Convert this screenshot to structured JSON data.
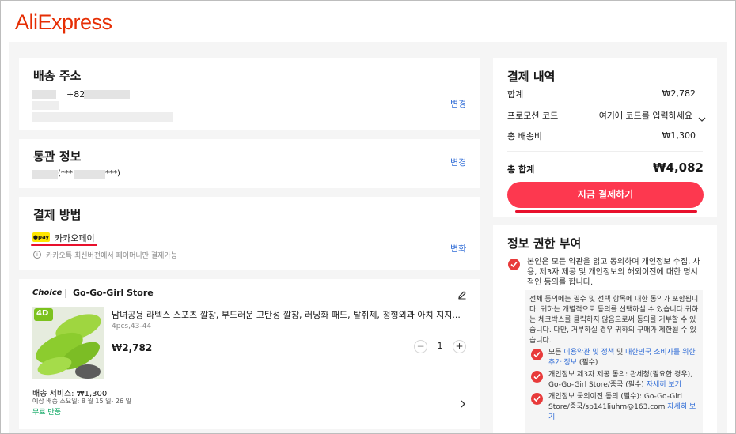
{
  "app": {
    "logo": "AliExpress",
    "brand_color": "#e62e04"
  },
  "shipping": {
    "title": "배송 주소",
    "phone_prefix": "+82",
    "change_label": "변경"
  },
  "customs": {
    "title": "통관 정보",
    "masked_id": "(***",
    "masked_tail": "***)",
    "change_label": "변경"
  },
  "payment_method": {
    "title": "결제 방법",
    "badge": "●pay",
    "method": "카카오페이",
    "notice": "카카오톡 최신버전에서 페이머니만 결제가능",
    "change_label": "변화"
  },
  "store": {
    "choice_label": "Choice",
    "name": "Go-Go-Girl Store",
    "item": {
      "title": "남녀공용 라텍스 스포츠 깔창, 부드러운 고탄성 깔창, 러닝화 패드, 탈취제, 정형외과 아치 지지...",
      "variant": "4pcs,43-44",
      "price": "₩2,782",
      "quantity": "1",
      "image_badge": "4D"
    },
    "shipping_service": "배송 서비스: ₩1,300",
    "delivery_estimate": "예상 배송 소요일: 8 월 15 일- 26 일",
    "free_return": "무료 반품"
  },
  "summary": {
    "title": "결제 내역",
    "subtotal_label": "합계",
    "subtotal_value": "₩2,782",
    "promo_label": "프로모션 코드",
    "promo_placeholder": "여기에 코드를 입력하세요",
    "shipping_label": "총 배송비",
    "shipping_value": "₩1,300",
    "total_label": "총 합계",
    "total_value": "₩4,082",
    "pay_button": "지금 결제하기"
  },
  "consent": {
    "title": "정보 권한 부여",
    "main": "본인은 모든 약관을 읽고 동의하며 개인정보 수집, 사용, 제3자 제공 및 개인정보의 해외이전에 대한 명시적인 동의를 합니다.",
    "note": "전체 동의에는 필수 및 선택 항목에 대한 동의가 포함됩니다. 귀하는 개별적으로 동의를 선택하실 수 있습니다.귀하는 체크박스를 클릭하지 않음으로써 동의를 거부할 수 있습니다. 다만, 거부하실 경우 귀하의 구매가 제한될 수 있습니다.",
    "item1_pre": "모든 ",
    "item1_link1": "이용약관 및 정책",
    "item1_mid": " 및 ",
    "item1_link2": "대한민국 소비자를 위한 추가 정보",
    "item1_post": " (필수)",
    "item2_text": "개인정보 제3자 제공 동의: 관세청(필요한 경우), Go-Go-Girl Store/중국 (필수) ",
    "item2_link": "자세히 보기",
    "item3_text": "개인정보 국외이전 동의 (필수): Go-Go-Girl Store/중국/sp141liuhm@163.com ",
    "item3_link": "자세히 보기"
  },
  "colors": {
    "accent": "#fd384f",
    "link": "#2e6bd6",
    "check": "#e83a3a",
    "kakao": "#ffe600"
  }
}
